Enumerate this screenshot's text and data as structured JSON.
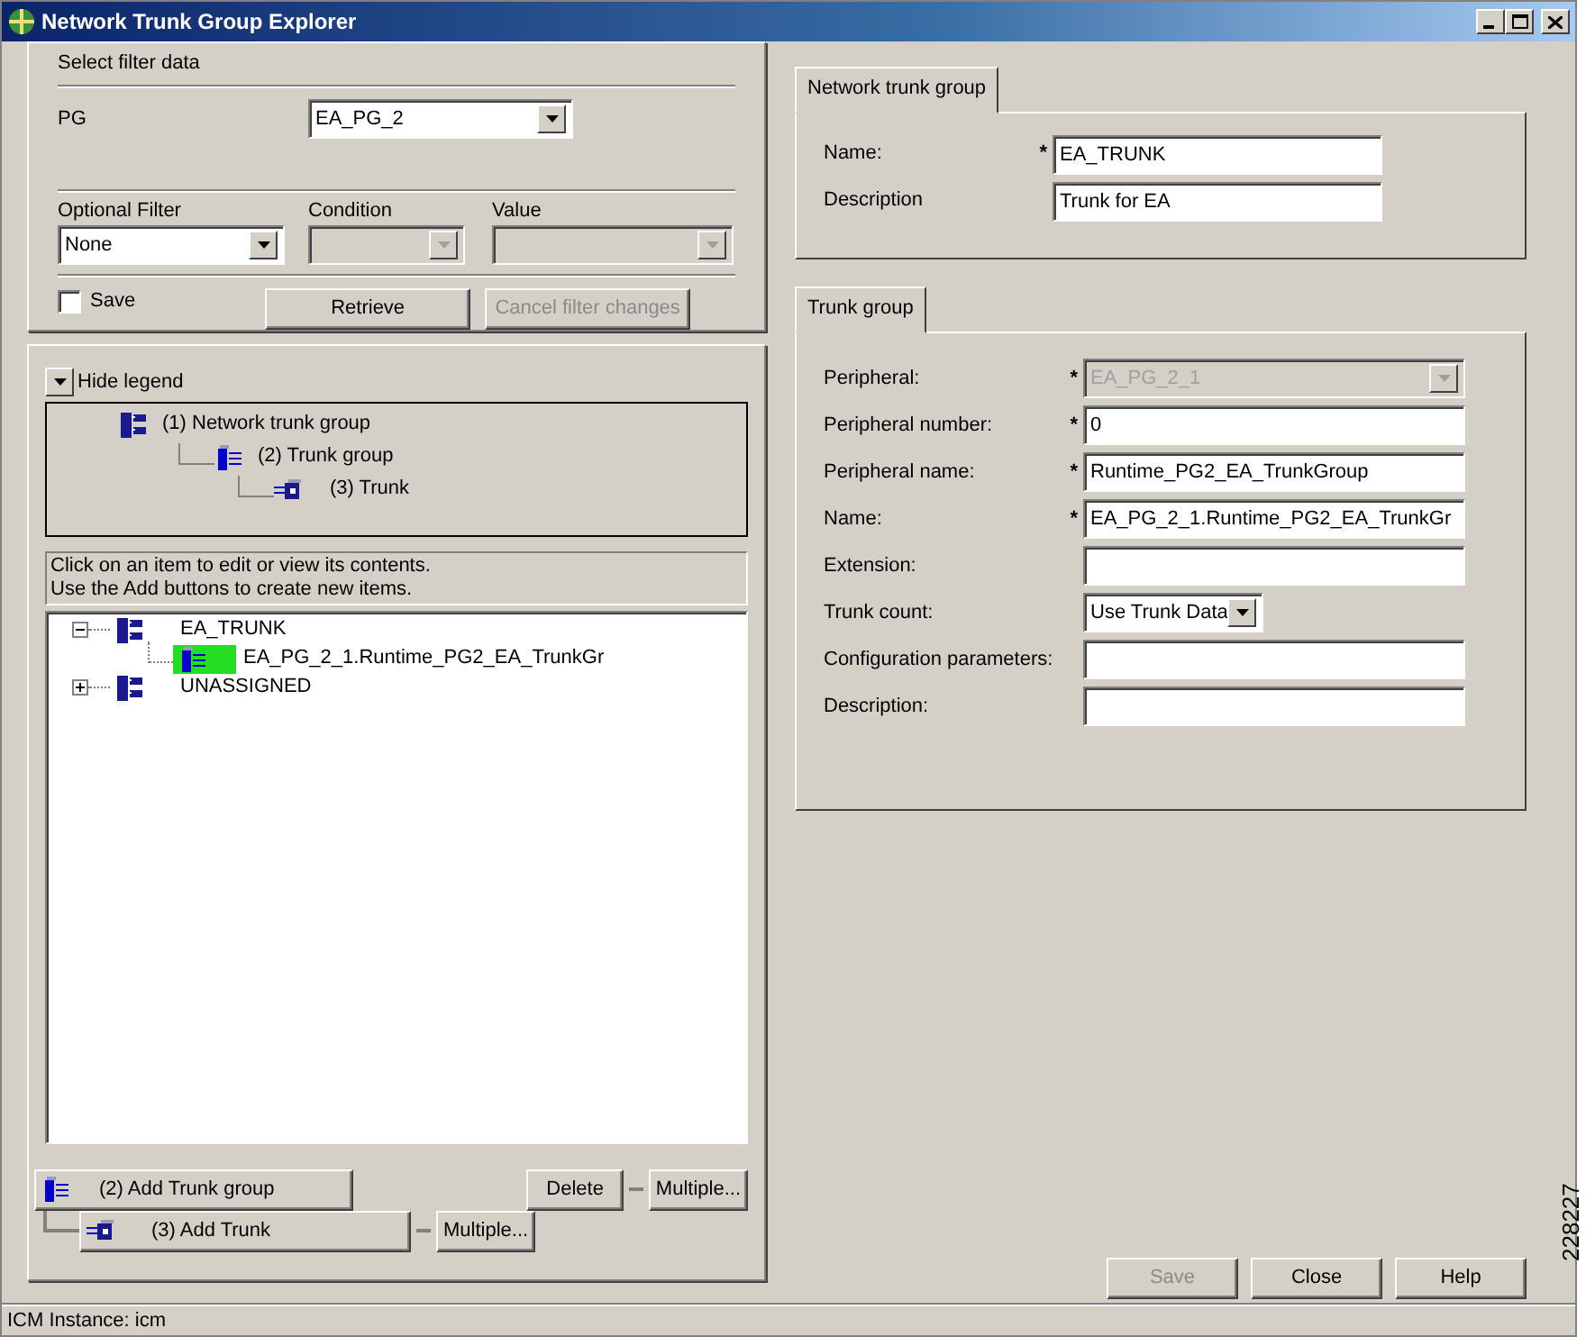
{
  "window": {
    "title": "Network Trunk Group Explorer"
  },
  "filter": {
    "title": "Select filter data",
    "pg_label": "PG",
    "pg_value": "EA_PG_2",
    "optional_filter": {
      "label": "Optional Filter",
      "value": "None",
      "disabled": false
    },
    "condition": {
      "label": "Condition",
      "disabled": true
    },
    "value": {
      "label": "Value",
      "disabled": true
    },
    "save": {
      "label": "Save",
      "checked": false
    },
    "buttons": [
      {
        "label": "Retrieve",
        "disabled": false
      },
      {
        "label": "Cancel filter changes",
        "disabled": true
      }
    ]
  },
  "legend": {
    "toggle": "Hide legend",
    "items": [
      {
        "kind": "network",
        "label": "(1) Network trunk group",
        "children": [
          {
            "kind": "trunk_group",
            "label": "(2) Trunk group",
            "children": [
              {
                "kind": "trunk",
                "label": "(3) Trunk"
              }
            ]
          }
        ]
      }
    ]
  },
  "hint": [
    "Click on an item to edit or view its contents.",
    "Use the Add buttons to create new items."
  ],
  "tree": [
    {
      "kind": "network",
      "label": "EA_TRUNK",
      "expanded": true,
      "selected": false,
      "children": [
        {
          "kind": "trunk_group",
          "label": "EA_PG_2_1.Runtime_PG2_EA_TrunkGr",
          "selected": true
        }
      ]
    },
    {
      "kind": "network",
      "label": "UNASSIGNED",
      "expanded": false,
      "selected": false
    }
  ],
  "actions": {
    "add_trunk_group": {
      "label": "(2) Add Trunk group"
    },
    "delete": {
      "label": "Delete"
    },
    "multiple_group": {
      "label": "Multiple..."
    },
    "add_trunk": {
      "label": "(3) Add Trunk"
    },
    "multiple_trunk": {
      "label": "Multiple..."
    }
  },
  "network_tab": {
    "tab": "Network trunk group",
    "fields": [
      {
        "kind": "text",
        "label": "Name:",
        "marker": "*",
        "value": "EA_TRUNK"
      },
      {
        "kind": "text",
        "label": "Description",
        "value": "Trunk for EA"
      }
    ]
  },
  "trunk_tab": {
    "tab": "Trunk group",
    "fields": [
      {
        "kind": "combo",
        "label": "Peripheral:",
        "marker": "*",
        "value": "EA_PG_2_1",
        "disabled": true
      },
      {
        "kind": "text",
        "label": "Peripheral number:",
        "marker": "*",
        "value": "0"
      },
      {
        "kind": "text",
        "label": "Peripheral name:",
        "marker": "*",
        "value": "Runtime_PG2_EA_TrunkGroup"
      },
      {
        "kind": "text",
        "label": "Name:",
        "marker": "*",
        "value": "EA_PG_2_1.Runtime_PG2_EA_TrunkGr"
      },
      {
        "kind": "text",
        "label": "Extension:"
      },
      {
        "kind": "dropdown",
        "label": "Trunk count:",
        "value": "Use Trunk Data",
        "disabled": false
      },
      {
        "kind": "text",
        "label": "Configuration parameters:"
      },
      {
        "kind": "text",
        "label": "Description:"
      }
    ]
  },
  "dialog_buttons": [
    {
      "label": "Save",
      "disabled": true
    },
    {
      "label": "Close",
      "disabled": false
    },
    {
      "label": "Help",
      "disabled": false
    }
  ],
  "status_bar": "ICM Instance: icm",
  "figure_number": "228227"
}
